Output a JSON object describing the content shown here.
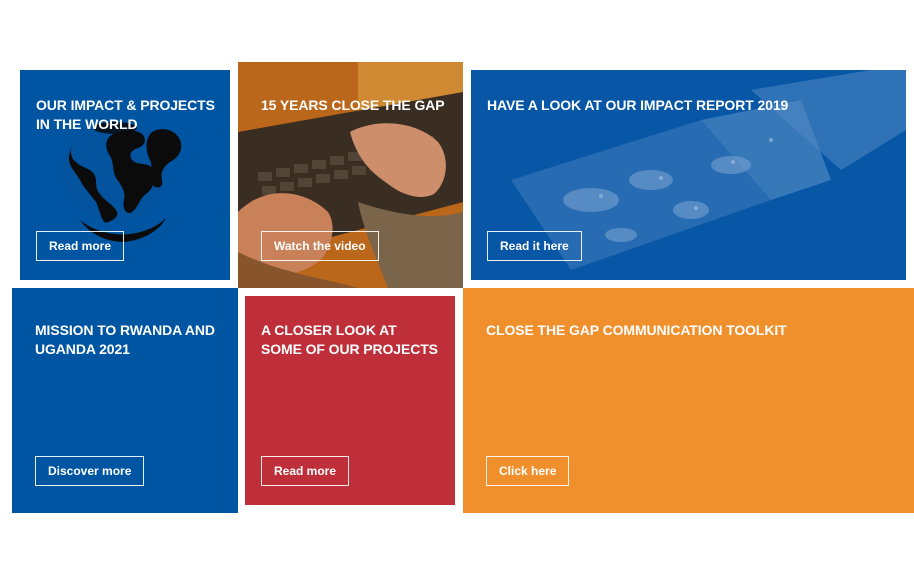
{
  "tiles": [
    {
      "title": "OUR IMPACT & PROJECTS IN THE WORLD",
      "button": "Read more"
    },
    {
      "title": "15 YEARS CLOSE THE GAP",
      "button": "Watch the video"
    },
    {
      "title": "HAVE A LOOK AT OUR IMPACT REPORT 2019",
      "button": "Read it here"
    },
    {
      "title": "MISSION TO RWANDA AND UGANDA 2021",
      "button": "Discover more"
    },
    {
      "title": "A CLOSER LOOK AT SOME OF OUR PROJECTS",
      "button": "Read more"
    },
    {
      "title": "CLOSE THE GAP COMMUNICATION TOOLKIT",
      "button": "Click here"
    }
  ],
  "colors": {
    "blue": "#0055a3",
    "red": "#bf2f3a",
    "orange": "#f0902c"
  },
  "icons": [
    "globe-icon",
    "keyboard-hands-photo",
    "impact-report-photo"
  ]
}
